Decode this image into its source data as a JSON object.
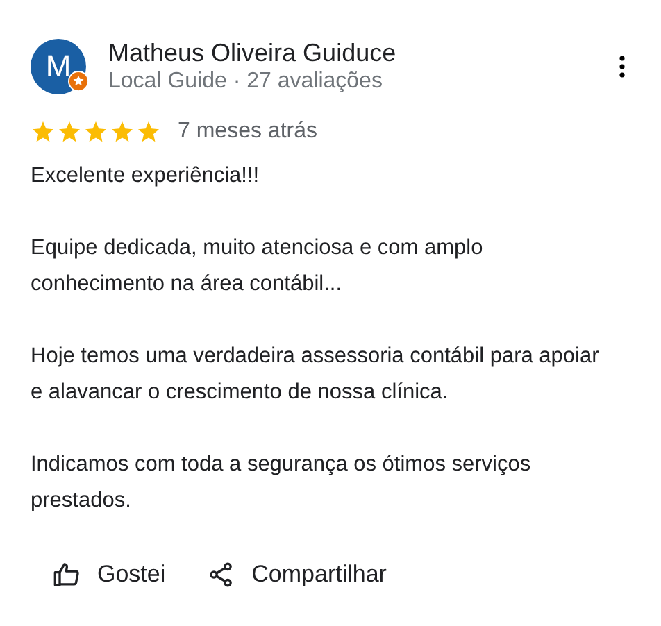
{
  "review": {
    "avatar_letter": "M",
    "local_guide_badge": true,
    "author": "Matheus Oliveira Guiduce",
    "subtitle": "Local Guide · 27 avaliações",
    "stars": 5,
    "time": "7 meses atrás",
    "paragraphs": [
      "Excelente experiência!!!",
      "Equipe dedicada, muito atenciosa e com amplo conhecimento na área contábil...",
      "Hoje temos uma verdadeira assessoria contábil para apoiar e alavancar o crescimento de nossa clínica.",
      "Indicamos com toda a segurança os ótimos serviços prestados."
    ],
    "actions": [
      {
        "kind": "like",
        "label": "Gostei"
      },
      {
        "kind": "share",
        "label": "Compartilhar"
      }
    ]
  }
}
